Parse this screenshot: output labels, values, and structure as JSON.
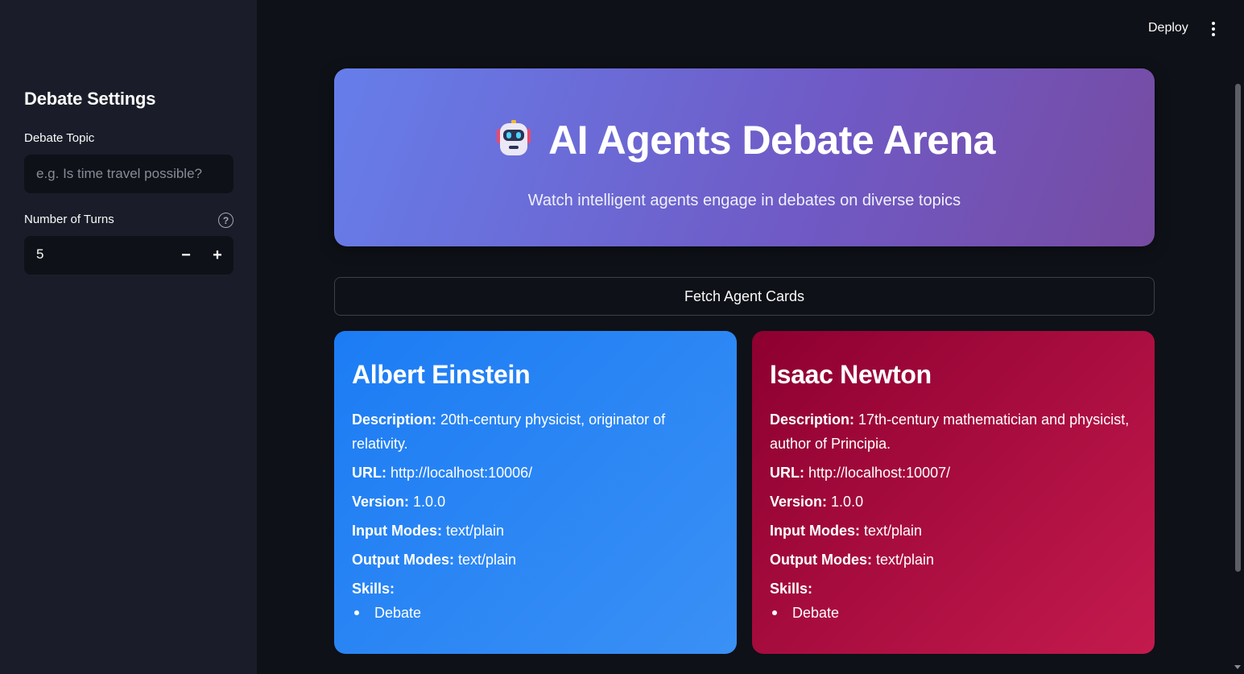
{
  "header": {
    "deploy_label": "Deploy",
    "menu_icon": "kebab-menu-icon"
  },
  "sidebar": {
    "title": "Debate Settings",
    "topic": {
      "label": "Debate Topic",
      "value": "",
      "placeholder": "e.g. Is time travel possible?"
    },
    "turns": {
      "label": "Number of Turns",
      "value": "5",
      "help_icon": "?",
      "minus": "−",
      "plus": "+"
    }
  },
  "hero": {
    "icon": "robot-icon",
    "title": "AI Agents Debate Arena",
    "subtitle": "Watch intelligent agents engage in debates on diverse topics"
  },
  "fetch_button": {
    "label": "Fetch Agent Cards"
  },
  "agents": [
    {
      "name": "Albert Einstein",
      "description_label": "Description:",
      "description": "20th-century physicist, originator of relativity.",
      "url_label": "URL:",
      "url": "http://localhost:10006/",
      "version_label": "Version:",
      "version": "1.0.0",
      "input_label": "Input Modes:",
      "input_modes": "text/plain",
      "output_label": "Output Modes:",
      "output_modes": "text/plain",
      "skills_label": "Skills:",
      "skills": [
        "Debate"
      ]
    },
    {
      "name": "Isaac Newton",
      "description_label": "Description:",
      "description": "17th-century mathematician and physicist, author of Principia.",
      "url_label": "URL:",
      "url": "http://localhost:10007/",
      "version_label": "Version:",
      "version": "1.0.0",
      "input_label": "Input Modes:",
      "input_modes": "text/plain",
      "output_label": "Output Modes:",
      "output_modes": "text/plain",
      "skills_label": "Skills:",
      "skills": [
        "Debate"
      ]
    }
  ],
  "colors": {
    "background": "#0e1117",
    "sidebar": "#1a1d29",
    "hero_start": "#667eea",
    "hero_end": "#764ba2",
    "card_einstein": "#1c7cf4",
    "card_newton": "#8d0030"
  }
}
